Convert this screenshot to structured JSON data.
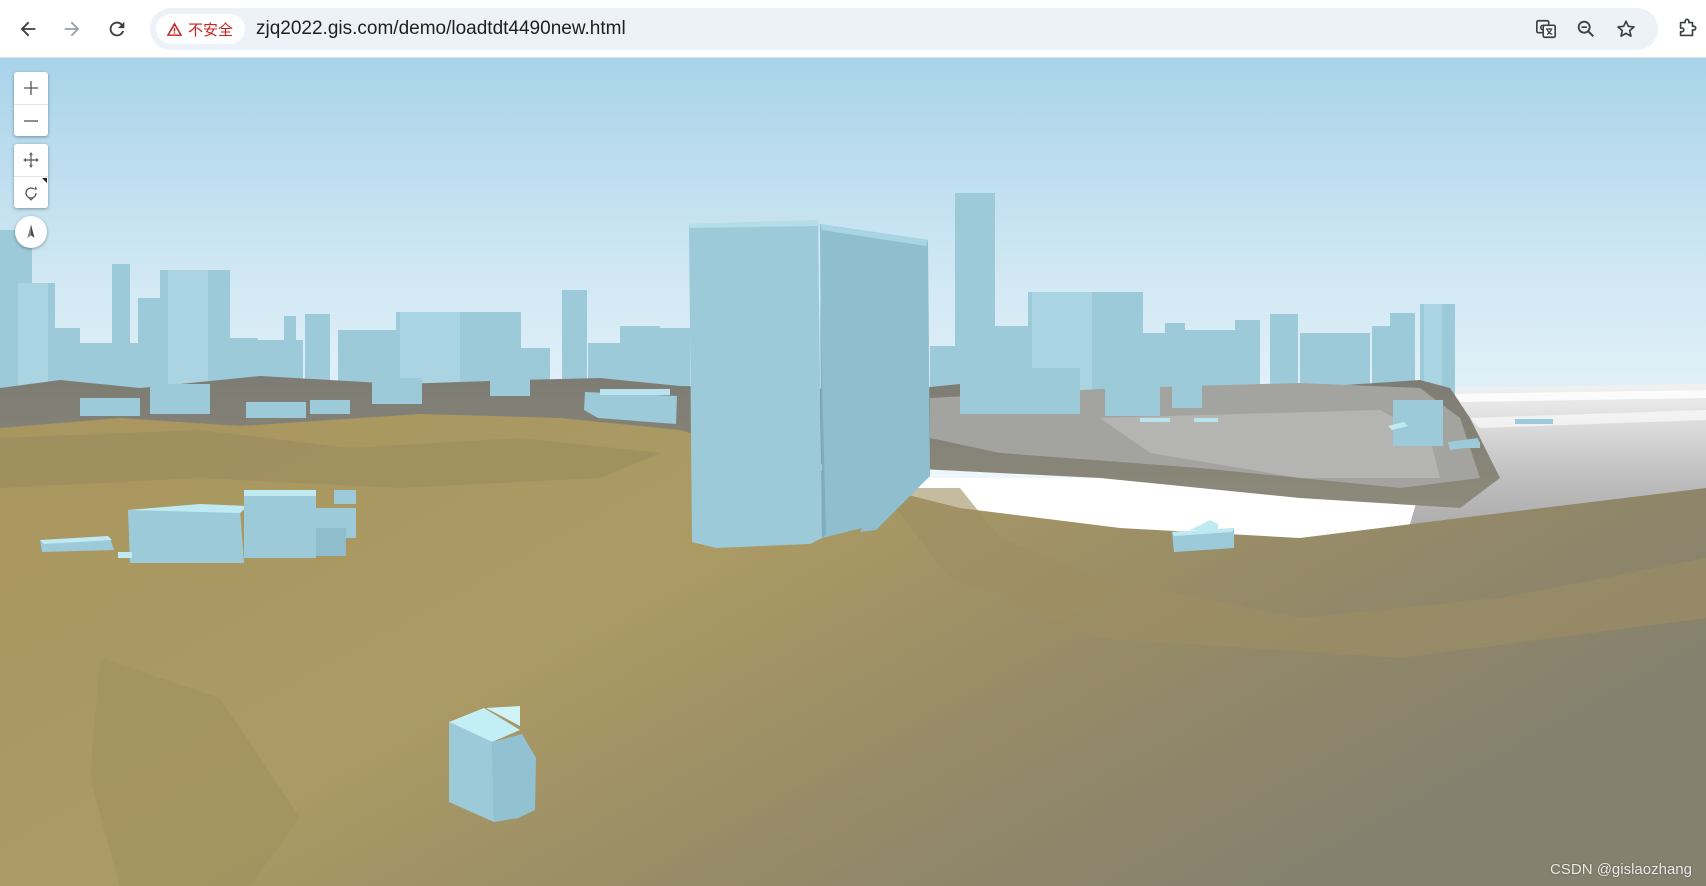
{
  "browser": {
    "security_label": "不安全",
    "url": "zjq2022.gis.com/demo/loadtdt4490new.html",
    "icons": {
      "back": "arrow-left-icon",
      "forward": "arrow-right-icon",
      "reload": "reload-icon",
      "warning": "warning-triangle-icon",
      "translate": "translate-icon",
      "zoom": "magnifier-icon",
      "bookmark": "star-icon",
      "extensions": "puzzle-icon"
    }
  },
  "map": {
    "controls": [
      "zoom-in",
      "zoom-out",
      "pan",
      "rotate",
      "compass"
    ],
    "colors": {
      "sky_top": "#a9d3ea",
      "sky_horizon": "#edf6fb",
      "building": "#9ccad9",
      "building_light": "#bfeaf2",
      "terrain_near": "#ad9b66",
      "terrain_far": "#8a8a86",
      "water": "#d9d9d9"
    }
  },
  "watermark": "CSDN @gislaozhang"
}
